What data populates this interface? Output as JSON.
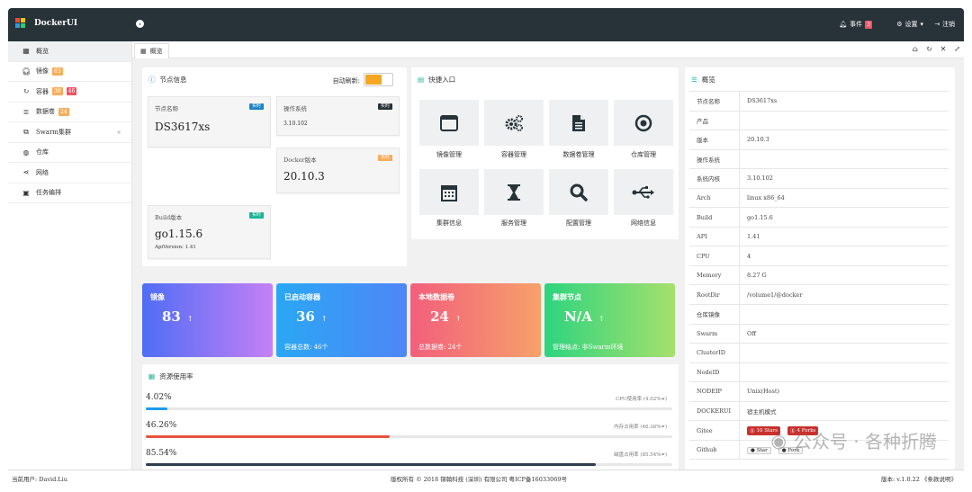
{
  "app": {
    "title": "DockerUI"
  },
  "topbar": {
    "events_label": "事件",
    "events_count": "3",
    "settings_label": "设置",
    "logout_label": "注销"
  },
  "sidebar": {
    "items": [
      {
        "label": "概览",
        "icon": "grid-icon"
      },
      {
        "label": "镜像",
        "icon": "headset-icon",
        "badges": [
          {
            "text": "83",
            "color": "#f8ac59"
          }
        ]
      },
      {
        "label": "容器",
        "icon": "refresh-icon",
        "badges": [
          {
            "text": "36",
            "color": "#f8ac59"
          },
          {
            "text": "46",
            "color": "#ed5565"
          }
        ]
      },
      {
        "label": "数据卷",
        "icon": "database-icon",
        "badges": [
          {
            "text": "24",
            "color": "#f8ac59"
          }
        ]
      },
      {
        "label": "Swarm集群",
        "icon": "sitemap-icon"
      },
      {
        "label": "仓库",
        "icon": "globe-icon"
      },
      {
        "label": "网络",
        "icon": "share-icon"
      },
      {
        "label": "任务编排",
        "icon": "tasks-icon"
      }
    ]
  },
  "tabs": {
    "home": "概览"
  },
  "node": {
    "title": "节点信息",
    "auto_refresh": "自动刷新:",
    "realtime_tag": "实时",
    "name_label": "节点名称",
    "name_value": "DS3617xs",
    "os_label": "操作系统",
    "os_value": "3.10.102",
    "docker_label": "Docker版本",
    "docker_value": "20.10.3",
    "build_label": "Build版本",
    "build_value": "go1.15.6",
    "build_sub": "ApiVersion: 1.41"
  },
  "quick": {
    "title": "快捷入口",
    "items": [
      {
        "label": "镜像管理",
        "icon": "window-icon"
      },
      {
        "label": "容器管理",
        "icon": "gears-icon"
      },
      {
        "label": "数据卷管理",
        "icon": "file-icon"
      },
      {
        "label": "仓库管理",
        "icon": "dot-circle-icon"
      },
      {
        "label": "集群信息",
        "icon": "calendar-icon"
      },
      {
        "label": "服务管理",
        "icon": "hourglass-icon"
      },
      {
        "label": "配置管理",
        "icon": "search-icon"
      },
      {
        "label": "网络信息",
        "icon": "usb-icon"
      }
    ]
  },
  "stats": [
    {
      "title": "镜像",
      "value": "83",
      "foot": ""
    },
    {
      "title": "已启动容器",
      "value": "36",
      "foot": "容器总数: 46个"
    },
    {
      "title": "本地数据卷",
      "value": "24",
      "foot": "总数据卷: 24个"
    },
    {
      "title": "集群节点",
      "value": "N/A",
      "foot": "管理结点: 非Swarm环境"
    }
  ],
  "resource": {
    "title": "资源使用率",
    "rows": [
      {
        "value": "4.02%",
        "label": "CPU使用率 (4.02%⏶)",
        "percent": 4.02,
        "color": "#1c9cf0"
      },
      {
        "value": "46.26%",
        "label": "内存占用率 (46.36%⏷)",
        "percent": 46.26,
        "color": "#e8533f"
      },
      {
        "value": "85.54%",
        "label": "磁盘占用率 (85.54%⏷)",
        "percent": 85.54,
        "color": "#2f3e4c"
      }
    ]
  },
  "overview": {
    "title": "概览",
    "rows": [
      {
        "k": "节点名称",
        "v": "DS3617xs"
      },
      {
        "k": "产品",
        "v": ""
      },
      {
        "k": "版本",
        "v": "20.10.3"
      },
      {
        "k": "操作系统",
        "v": ""
      },
      {
        "k": "系统内核",
        "v": "3.10.102"
      },
      {
        "k": "Arch",
        "v": "linux x86_64"
      },
      {
        "k": "Build",
        "v": "go1.15.6"
      },
      {
        "k": "API",
        "v": "1.41"
      },
      {
        "k": "CPU",
        "v": "4"
      },
      {
        "k": "Memory",
        "v": "8.27 G"
      },
      {
        "k": "RootDir",
        "v": "/volume1/@docker"
      },
      {
        "k": "仓库镜像",
        "v": ""
      },
      {
        "k": "Swarm",
        "v": "Off"
      },
      {
        "k": "ClusterID",
        "v": ""
      },
      {
        "k": "NodeID",
        "v": ""
      },
      {
        "k": "NODEIP",
        "v": "Unix(Host)"
      },
      {
        "k": "DOCKERUI",
        "v": "宿主机模式"
      },
      {
        "k": "Gitee",
        "v": ""
      },
      {
        "k": "Github",
        "v": ""
      }
    ],
    "gitee": {
      "stars": "10 Stars",
      "forks": "4 Forks"
    },
    "github": {
      "star": "Star",
      "fork": "Fork"
    }
  },
  "footer": {
    "user": "当前用户: David.Liu",
    "copyright": "版权所有 © 2018 锦翰科技 (深圳) 有限公司 粤ICP备16033069号",
    "version": "版本: v.1.0.22 《条款说明》"
  },
  "watermark": {
    "text": "公众号 · 各种折腾"
  }
}
